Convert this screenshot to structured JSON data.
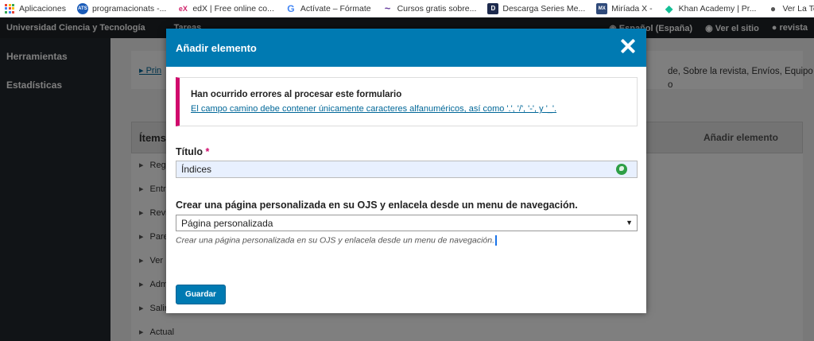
{
  "bookmarks": {
    "items": [
      {
        "label": "Aplicaciones",
        "icon": "apps-grid-icon"
      },
      {
        "label": "programacionats -...",
        "icon": "ats-icon",
        "badge": "ATS",
        "color": "#1a5bb8"
      },
      {
        "label": "edX | Free online co...",
        "icon": "edx-icon",
        "badge": "eX",
        "color": "#02262b"
      },
      {
        "label": "Actívate – Fórmate",
        "icon": "google-icon",
        "badge": "G",
        "color": "#4285f4"
      },
      {
        "label": "Cursos gratis sobre...",
        "icon": "wave-icon",
        "badge": "~",
        "color": "#6a3fa0"
      },
      {
        "label": "Descarga Series Me...",
        "icon": "d-icon",
        "badge": "D",
        "color": "#1d2a4d"
      },
      {
        "label": "Miríada X -",
        "icon": "mx-icon",
        "badge": "MX",
        "color": "#2f4a7a"
      },
      {
        "label": "Khan Academy | Pr...",
        "icon": "khan-icon",
        "badge": "◆",
        "color": "#14bf96"
      },
      {
        "label": "Ver La Teoria del bi...",
        "icon": "globe-icon",
        "badge": "●",
        "color": "#666666"
      }
    ]
  },
  "topbar": {
    "site": "Universidad Ciencia y Tecnología",
    "tasks": "Tareas",
    "language": "Español (España)",
    "view_site": "Ver el sitio",
    "user": "revista"
  },
  "sidebar": {
    "items": [
      "Herramientas",
      "Estadísticas"
    ]
  },
  "background": {
    "crumb": "Prin",
    "crumb_right": "de, Sobre la revista, Envíos, Equipo\no",
    "items_title": "Ítems",
    "add_item": "Añadir elemento",
    "list": [
      "Regi",
      "Entr",
      "Revi",
      "Pare",
      "Ver",
      "Adm",
      "Salir",
      "Actual"
    ]
  },
  "modal": {
    "title": "Añadir elemento",
    "error_title": "Han ocurrido errores al procesar este formulario",
    "error_link": "El campo camino debe contener únicamente caracteres alfanuméricos, así como '.', '/', '-', y '_'.",
    "title_label": "Título",
    "required_mark": "*",
    "title_value": "Índices",
    "type_label": "Crear una página personalizada en su OJS y enlacela desde un menu de navegación.",
    "type_selected": "Página personalizada",
    "type_help": "Crear una página personalizada en su OJS y enlacela desde un menu de navegación.",
    "save": "Guardar"
  },
  "colors": {
    "header_blue": "#007ab2",
    "error_accent": "#d00a6c",
    "sidebar_dark": "#23282e"
  }
}
